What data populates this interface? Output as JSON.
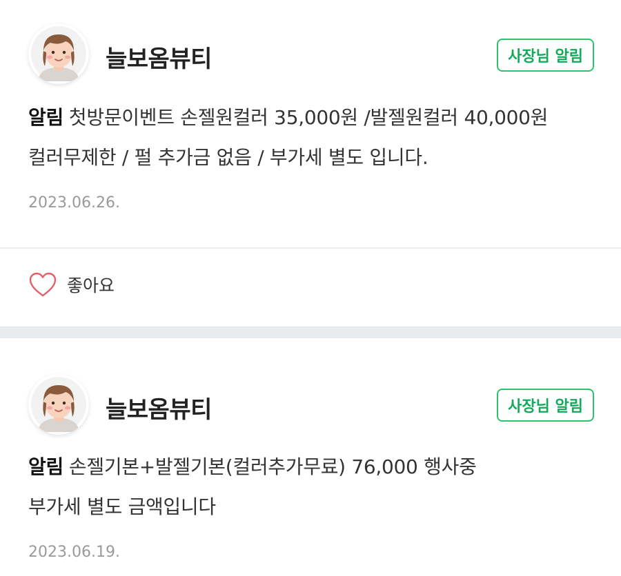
{
  "posts": [
    {
      "shop_name": "늘보옴뷰티",
      "badge": "사장님 알림",
      "tag": "알림",
      "line1": "첫방문이벤트 손젤원컬러 35,000원 /발젤원컬러 40,000원",
      "line2": "컬러무제한 / 펄 추가금 없음 / 부가세 별도 입니다.",
      "date": "2023.06.26."
    },
    {
      "shop_name": "늘보옴뷰티",
      "badge": "사장님 알림",
      "tag": "알림",
      "line1": "손젤기본+발젤기본(컬러추가무료) 76,000 행사중",
      "line2": "부가세 별도 금액입니다",
      "date": "2023.06.19."
    }
  ],
  "like": {
    "label": "좋아요",
    "icon": "heart-outline-icon",
    "color": "#e0606a"
  },
  "colors": {
    "badge_border": "#2cc26b",
    "badge_text": "#14a85a",
    "date": "#9a9a9a"
  }
}
